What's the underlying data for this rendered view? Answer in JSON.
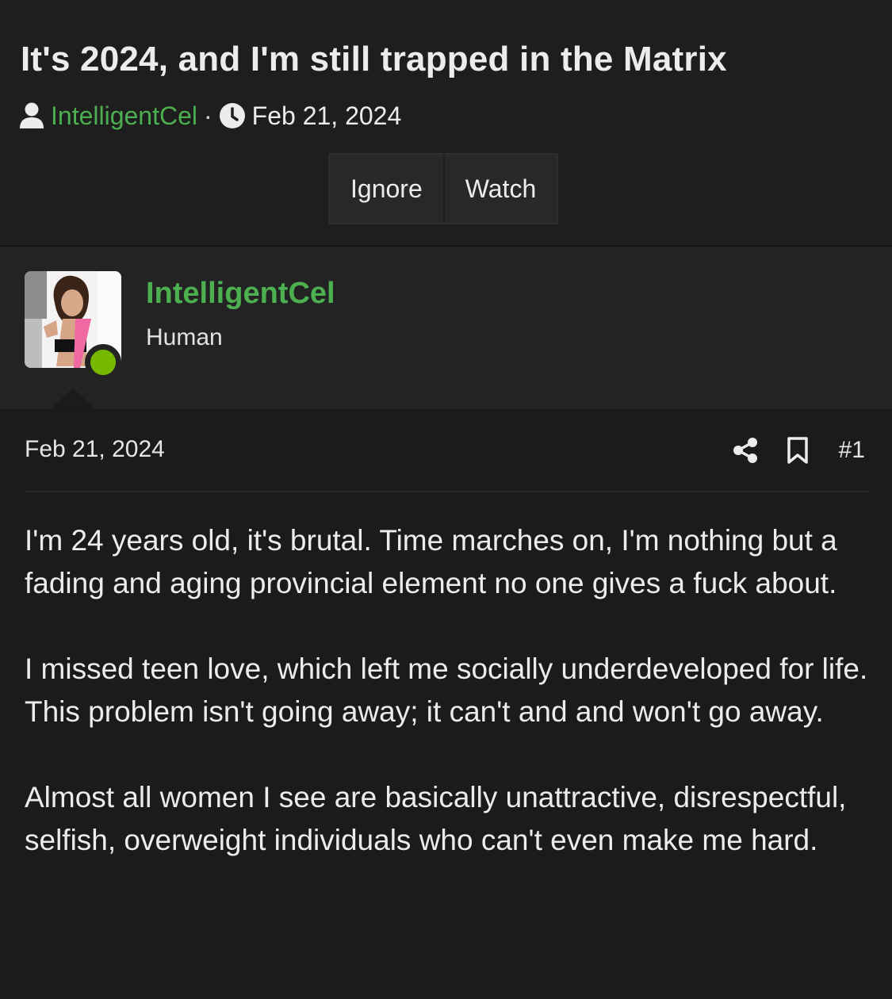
{
  "thread": {
    "title": "It's 2024, and I'm still trapped in the Matrix",
    "author": "IntelligentCel",
    "separator": "·",
    "date": "Feb 21, 2024"
  },
  "buttons": {
    "ignore": "Ignore",
    "watch": "Watch"
  },
  "user": {
    "name": "IntelligentCel",
    "title": "Human",
    "online_status_color": "#76b900"
  },
  "post": {
    "date": "Feb 21, 2024",
    "number": "#1",
    "paragraphs": [
      "I'm 24 years old, it's brutal. Time marches on, I'm nothing but a fading and aging provincial element no one gives a fuck about.",
      "I missed teen love, which left me socially underdeveloped for life. This problem isn't going away; it can't and and won't go away.",
      "Almost all women I see are basically unattractive, disrespectful, selfish, overweight individuals who can't even make me hard."
    ]
  },
  "colors": {
    "accent": "#4caf50",
    "background": "#1b1b1b",
    "user_block": "#232323"
  },
  "icons": [
    "user-icon",
    "clock-icon",
    "share-icon",
    "bookmark-icon"
  ]
}
